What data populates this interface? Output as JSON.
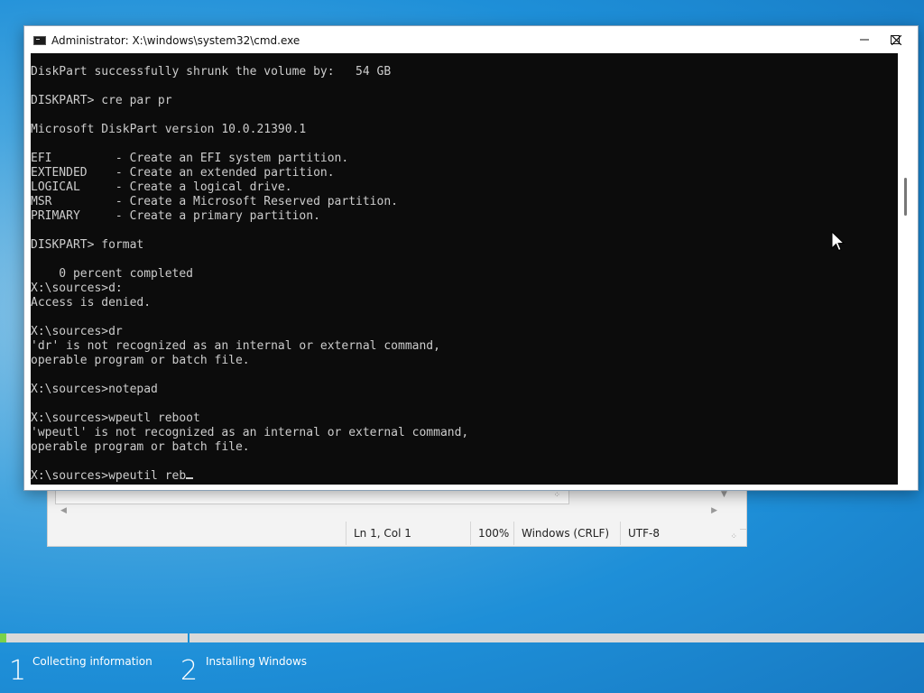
{
  "notepad": {
    "status": {
      "position": "Ln 1, Col 1",
      "zoom": "100%",
      "line_endings": "Windows (CRLF)",
      "encoding": "UTF-8"
    }
  },
  "cmd": {
    "title": "Administrator: X:\\windows\\system32\\cmd.exe",
    "buttons": {
      "minimize": "—",
      "maximize": "☐",
      "close": "✕"
    },
    "lines": [
      "DiskPart successfully shrunk the volume by:   54 GB",
      "",
      "DISKPART> cre par pr",
      "",
      "Microsoft DiskPart version 10.0.21390.1",
      "",
      "EFI         - Create an EFI system partition.",
      "EXTENDED    - Create an extended partition.",
      "LOGICAL     - Create a logical drive.",
      "MSR         - Create a Microsoft Reserved partition.",
      "PRIMARY     - Create a primary partition.",
      "",
      "DISKPART> format",
      "",
      "    0 percent completed",
      "X:\\sources>d:",
      "Access is denied.",
      "",
      "X:\\sources>dr",
      "'dr' is not recognized as an internal or external command,",
      "operable program or batch file.",
      "",
      "X:\\sources>notepad",
      "",
      "X:\\sources>wpeutl reboot",
      "'wpeutl' is not recognized as an internal or external command,",
      "operable program or batch file.",
      ""
    ],
    "current_input": "X:\\sources>wpeutil reb"
  },
  "setup": {
    "progress": 0.007,
    "steps": [
      {
        "number": "1",
        "label": "Collecting information"
      },
      {
        "number": "2",
        "label": "Installing Windows"
      }
    ]
  }
}
